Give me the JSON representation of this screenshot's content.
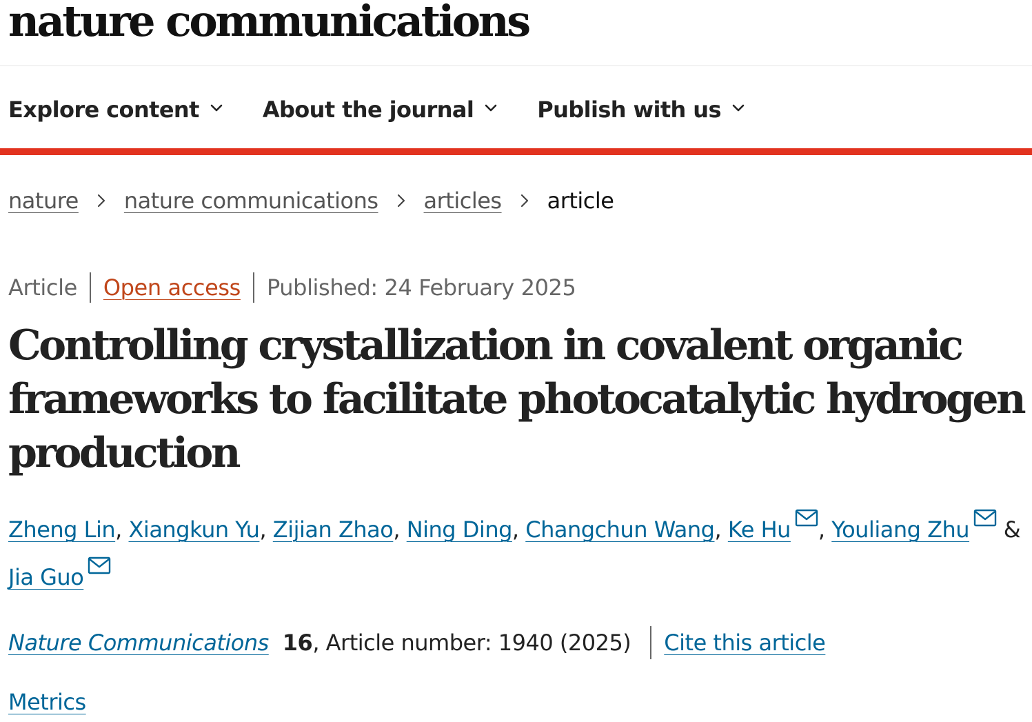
{
  "site": {
    "logo_text": "nature communications"
  },
  "nav": {
    "items": [
      {
        "label": "Explore content",
        "icon": "chevron-down-icon"
      },
      {
        "label": "About the journal",
        "icon": "chevron-down-icon"
      },
      {
        "label": "Publish with us",
        "icon": "chevron-down-icon"
      }
    ]
  },
  "breadcrumb": {
    "items": [
      {
        "label": "nature"
      },
      {
        "label": "nature communications"
      },
      {
        "label": "articles"
      }
    ],
    "current": "article"
  },
  "meta": {
    "type": "Article",
    "access": "Open access",
    "published": "Published: 24 February 2025"
  },
  "article": {
    "title": "Controlling crystallization in covalent organic frameworks to facilitate photocatalytic hydrogen production"
  },
  "authors": [
    {
      "name": "Zheng Lin",
      "corresponding": false
    },
    {
      "name": "Xiangkun Yu",
      "corresponding": false
    },
    {
      "name": "Zijian Zhao",
      "corresponding": false
    },
    {
      "name": "Ning Ding",
      "corresponding": false
    },
    {
      "name": "Changchun Wang",
      "corresponding": false
    },
    {
      "name": "Ke Hu",
      "corresponding": true
    },
    {
      "name": "Youliang Zhu",
      "corresponding": true
    },
    {
      "name": "Jia Guo",
      "corresponding": true
    }
  ],
  "authors_separators": {
    "comma": ", ",
    "ampersand": " & "
  },
  "citation": {
    "journal": "Nature Communications",
    "volume": "16",
    "article_number_text": ", Article number: 1940 (2025)",
    "cite_label": "Cite this article"
  },
  "metrics_label": "Metrics",
  "colors": {
    "accent_red": "#e2331f",
    "link_blue": "#006699",
    "open_access_orange": "#c0461a",
    "text_dark": "#222222",
    "text_muted": "#666666"
  }
}
